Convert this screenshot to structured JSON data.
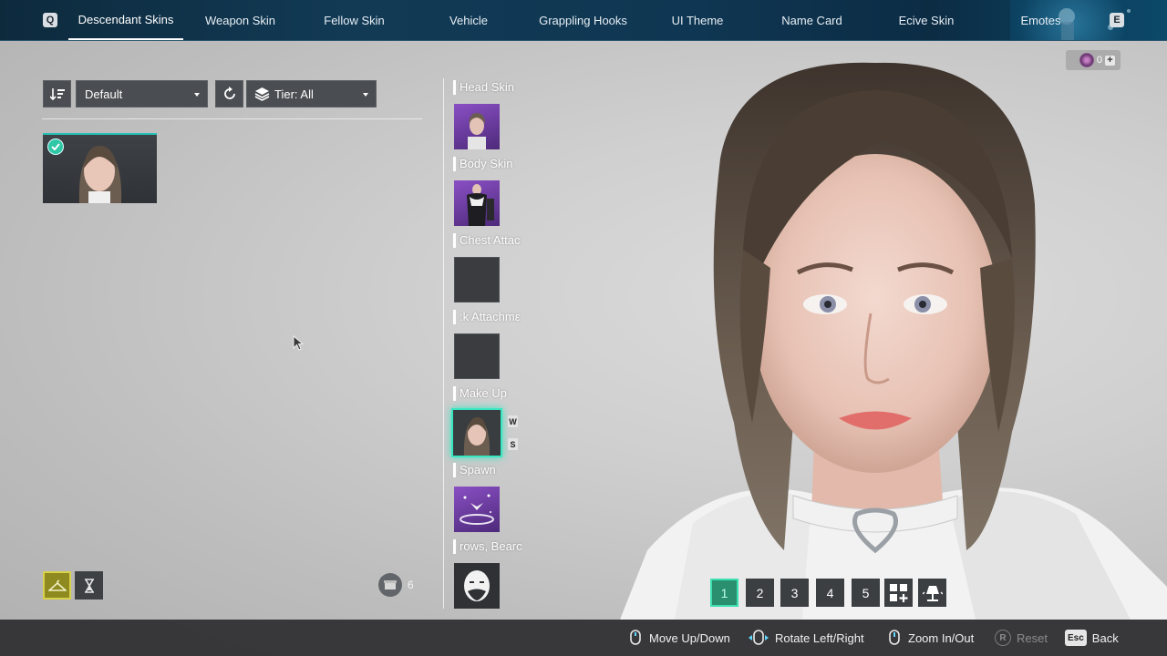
{
  "topbar": {
    "left_key": "Q",
    "right_key": "E",
    "tabs": [
      {
        "label": "Descendant Skins",
        "active": true
      },
      {
        "label": "Weapon Skin",
        "active": false
      },
      {
        "label": "Fellow Skin",
        "active": false
      },
      {
        "label": "Vehicle",
        "active": false
      },
      {
        "label": "Grappling Hooks",
        "active": false
      },
      {
        "label": "UI Theme",
        "active": false
      },
      {
        "label": "Name Card",
        "active": false
      },
      {
        "label": "Ecive Skin",
        "active": false
      },
      {
        "label": "Emotes",
        "active": false
      }
    ]
  },
  "currency": {
    "amount": "0",
    "icon": "caliber-coin-icon"
  },
  "filters": {
    "sort_icon": "sort-descending-icon",
    "sort_value": "Default",
    "reset_icon": "refresh-icon",
    "tier_icon": "layers-icon",
    "tier_value": "Tier: All"
  },
  "skins_list": {
    "owned_equipped": true
  },
  "slots": [
    {
      "label": "Head Skin",
      "thumb": "purple-head-thumbnail"
    },
    {
      "label": "Body Skin",
      "thumb": "purple-body-thumbnail"
    },
    {
      "label": "Chest Attac",
      "thumb": "empty"
    },
    {
      "label": ":k Attachmε",
      "thumb": "empty"
    },
    {
      "label": "Make Up",
      "thumb": "selected-makeup-thumbnail",
      "keys": [
        "W",
        "S"
      ]
    },
    {
      "label": "Spawn",
      "thumb": "purple-spawn-thumbnail"
    },
    {
      "label": "rows, Bearc",
      "thumb": "face-silhouette-icon"
    }
  ],
  "bottom_left": {
    "hanger_icon": "hanger-icon",
    "hourglass_icon": "hourglass-icon",
    "inventory_icon": "box-icon",
    "inventory_count": "6"
  },
  "presets": {
    "items": [
      "1",
      "2",
      "3",
      "4",
      "5"
    ],
    "active": "1"
  },
  "hints": [
    {
      "label": "Move Up/Down",
      "icon": "mouse-icon",
      "dim": false
    },
    {
      "label": "Rotate Left/Right",
      "icon": "mouse-icon",
      "dim": false
    },
    {
      "label": "Zoom In/Out",
      "icon": "mouse-icon",
      "dim": false
    },
    {
      "key": "R",
      "label": "Reset",
      "dim": true
    },
    {
      "key": "Esc",
      "label": "Back",
      "dim": false
    }
  ],
  "colors": {
    "accent": "#39e6c1",
    "topbar": "#123a55",
    "hintbar": "#2d2d30"
  }
}
